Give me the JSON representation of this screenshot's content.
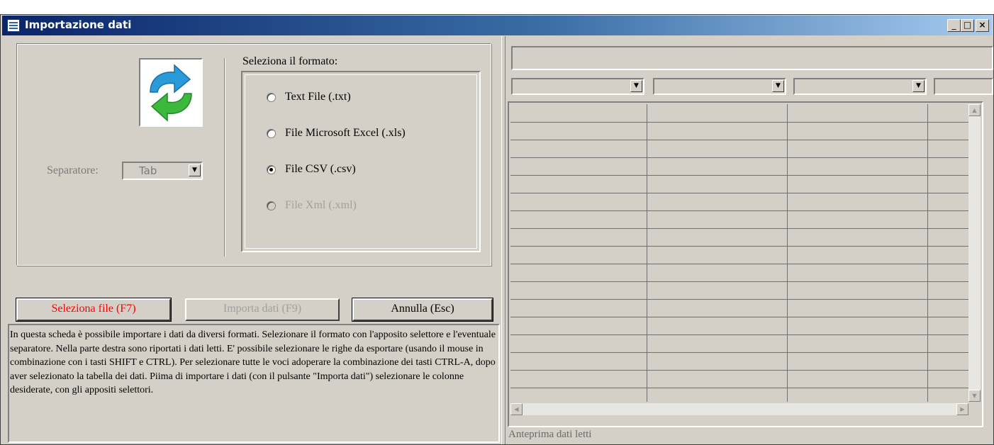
{
  "window": {
    "title": "Importazione dati",
    "minimize_glyph": "_",
    "maximize_glyph": "□",
    "close_glyph": "×"
  },
  "import_icon": "refresh-arrows-icon",
  "separator": {
    "label": "Separatore:",
    "value": "Tab"
  },
  "format": {
    "label": "Seleziona il formato:",
    "options": [
      {
        "label": "Text File (.txt)",
        "checked": false,
        "enabled": true
      },
      {
        "label": "File Microsoft Excel (.xls)",
        "checked": false,
        "enabled": true
      },
      {
        "label": "File CSV (.csv)",
        "checked": true,
        "enabled": true
      },
      {
        "label": "File Xml (.xml)",
        "checked": false,
        "enabled": false
      }
    ]
  },
  "buttons": {
    "select_file": "Seleziona file (F7)",
    "import_data": "Importa dati (F9)",
    "cancel": "Annulla  (Esc)"
  },
  "help_text": "In questa scheda è possibile importare i dati da diversi formati. Selezionare il formato con l'apposito selettore e l'eventuale separatore. Nella parte destra sono riportati i dati letti. E' possibile selezionare le righe da esportare (usando il mouse in combinazione con i tasti SHIFT e CTRL). Per selezionare tutte le voci adoperare la combinazione dei tasti CTRL-A, dopo aver selezionato la tabella dei dati. Piima di importare i dati (con il pulsante \"Importa dati\") selezionare le colonne desiderate, con gli appositi selettori.",
  "preview": {
    "path_value": "",
    "column_selectors": [
      "",
      "",
      "",
      ""
    ],
    "status_label": "Anteprima dati letti"
  },
  "colors": {
    "select_file_text": "#ff0000",
    "disabled_text": "#a0a0a0",
    "face": "#d4d0c8"
  }
}
